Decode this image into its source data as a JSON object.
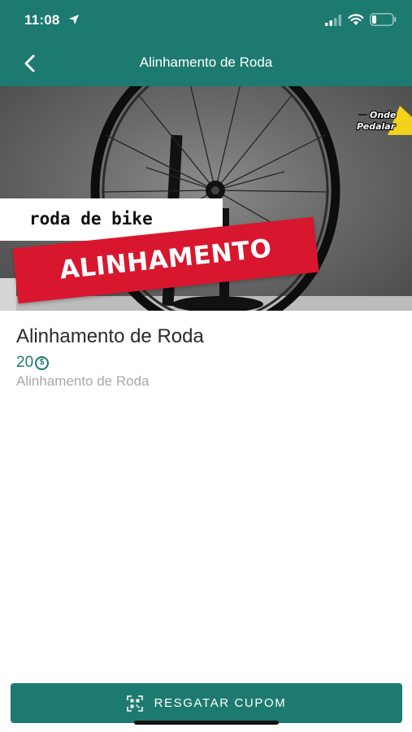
{
  "status_bar": {
    "time": "11:08"
  },
  "nav": {
    "title": "Alinhamento de Roda",
    "back_icon": "chevron-left-icon"
  },
  "hero": {
    "caption_top": "roda de bike",
    "caption_banner": "ALINHAMENTO",
    "logo_line1": "Onde",
    "logo_line2": "Pedalar"
  },
  "product": {
    "title": "Alinhamento de Roda",
    "price": "20",
    "price_icon": "coin-icon",
    "coin_symbol": "$",
    "description": "Alinhamento de Roda"
  },
  "action": {
    "redeem_label": "RESGATAR CUPOM",
    "redeem_icon": "qr-code-icon"
  },
  "colors": {
    "brand": "#1d7a70",
    "banner_red": "#d8172e"
  }
}
